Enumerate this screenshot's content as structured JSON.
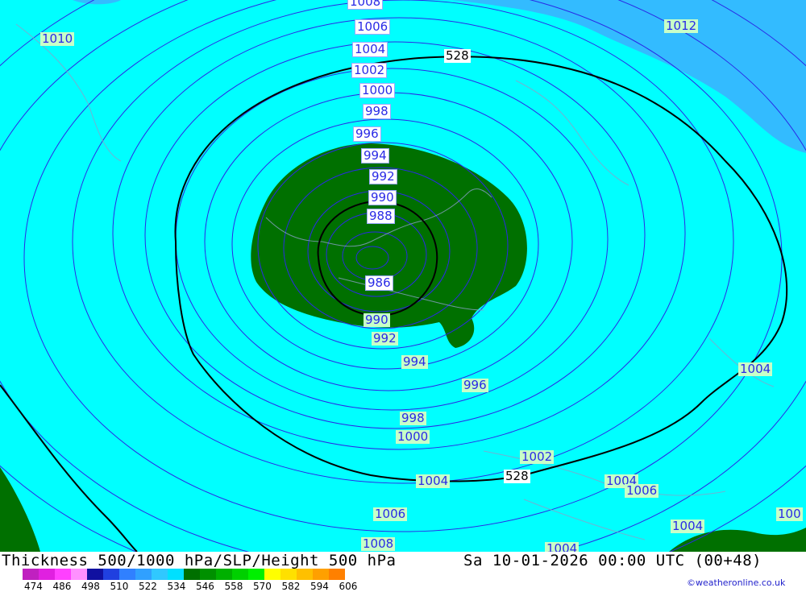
{
  "map": {
    "isobars_white": [
      "1008",
      "1006",
      "1004",
      "1002",
      "1000",
      "998",
      "996",
      "994",
      "992",
      "990",
      "988",
      "986"
    ],
    "isobars_green": [
      "1010",
      "1012",
      "990",
      "992",
      "994",
      "996",
      "998",
      "1000",
      "1002",
      "1004",
      "1004",
      "1004",
      "1006",
      "1006",
      "1008",
      "1004",
      "1004",
      "100"
    ],
    "thickness_labels": [
      "528",
      "528"
    ],
    "colors": {
      "cyan": "#00ffff",
      "light_blue": "#33bbff",
      "green": "#007000",
      "isobar": "#2a2ae6",
      "thickness_line": "#000000"
    }
  },
  "footer": {
    "title_left": "Thickness 500/1000 hPa/SLP/Height 500 hPa",
    "title_right": "Sa 10-01-2026 00:00 UTC (00+48)",
    "credit": "©weatheronline.co.uk",
    "colorbar_ticks": [
      "474",
      "486",
      "498",
      "510",
      "522",
      "534",
      "546",
      "558",
      "570",
      "582",
      "594",
      "606"
    ],
    "colorbar_colors": [
      "#c020c0",
      "#e020e0",
      "#ff40ff",
      "#ff90ff",
      "#1010a0",
      "#2040e0",
      "#3080ff",
      "#30a0ff",
      "#30c8ff",
      "#00e0ff",
      "#007000",
      "#009000",
      "#00b000",
      "#00d000",
      "#00f000",
      "#ffff00",
      "#ffe000",
      "#ffc000",
      "#ffa000",
      "#ff8000"
    ]
  }
}
